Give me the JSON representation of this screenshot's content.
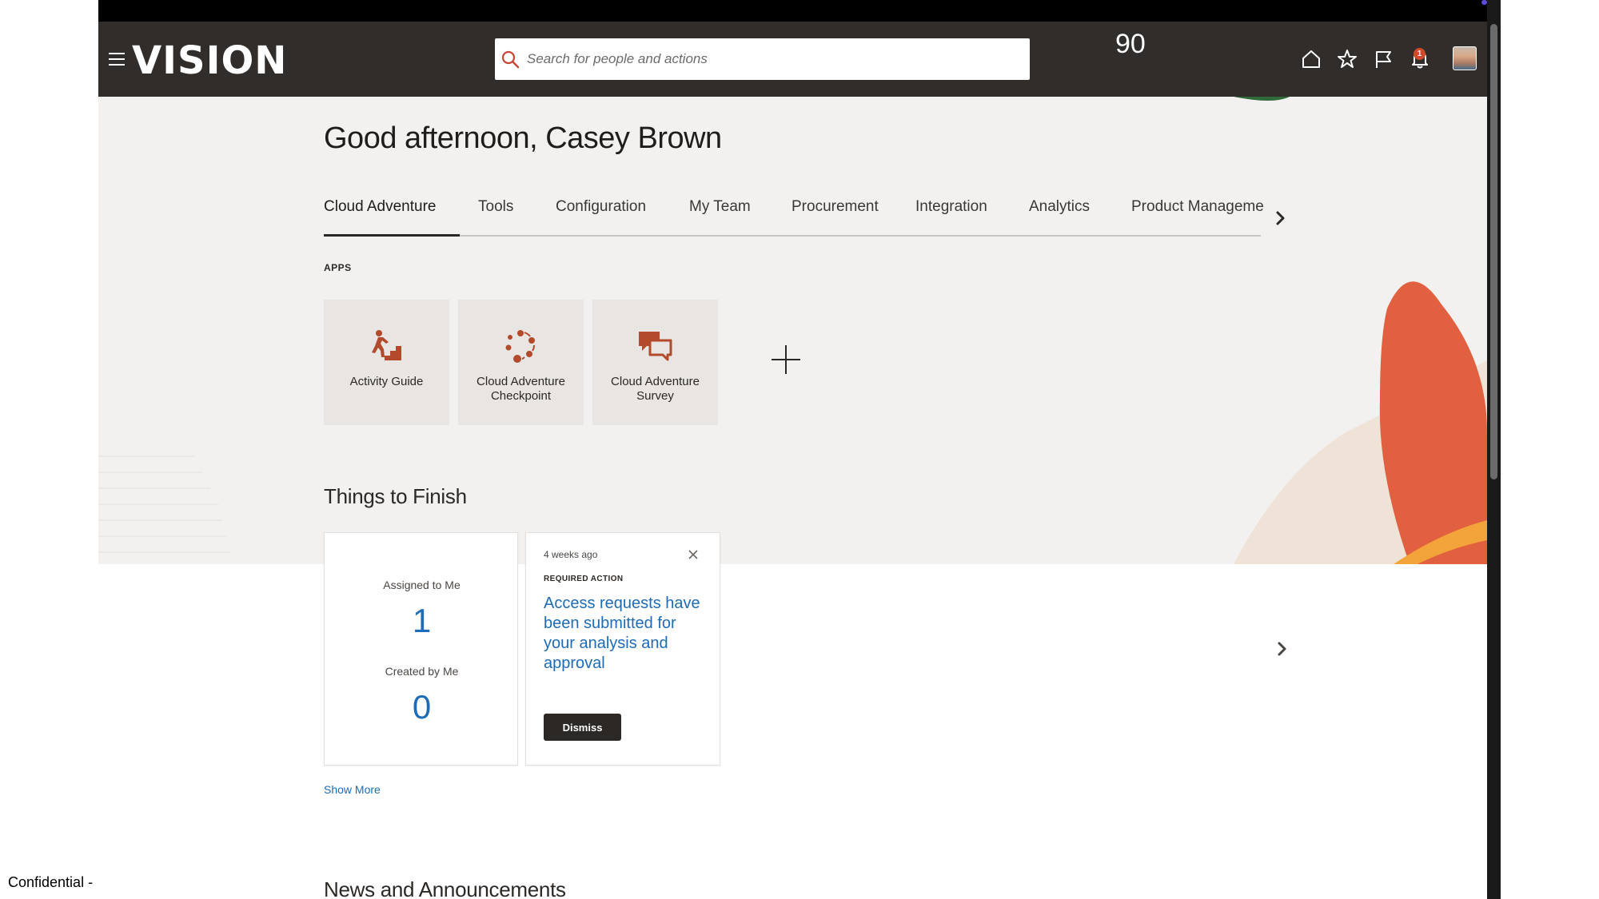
{
  "header": {
    "logo_text": "VISION",
    "search_placeholder": "Search for people and actions",
    "counter": "90",
    "notification_count": "1",
    "icons": [
      "menu-icon",
      "search-icon",
      "home-icon",
      "star-icon",
      "flag-icon",
      "bell-icon",
      "avatar"
    ]
  },
  "greeting": "Good afternoon, Casey Brown",
  "tabs": [
    {
      "label": "Cloud Adventure",
      "active": true
    },
    {
      "label": "Tools"
    },
    {
      "label": "Configuration"
    },
    {
      "label": "My Team"
    },
    {
      "label": "Procurement"
    },
    {
      "label": "Integration"
    },
    {
      "label": "Analytics"
    },
    {
      "label": "Product Manageme"
    }
  ],
  "apps": {
    "section_label": "APPS",
    "items": [
      {
        "label": "Activity Guide",
        "icon": "climbing-stairs-icon"
      },
      {
        "label": "Cloud Adventure Checkpoint",
        "icon": "cycle-dots-icon"
      },
      {
        "label": "Cloud Adventure Survey",
        "icon": "chat-bubbles-icon"
      }
    ]
  },
  "things_to_finish": {
    "title": "Things to Finish",
    "assigned_label": "Assigned to Me",
    "assigned_count": "1",
    "created_label": "Created by Me",
    "created_count": "0",
    "action_card": {
      "time": "4 weeks ago",
      "type": "REQUIRED ACTION",
      "title": "Access requests have been submitted for your analysis and approval",
      "dismiss_label": "Dismiss"
    },
    "show_more": "Show More"
  },
  "news_title": "News and Announcements",
  "footer_note": "Confidential -",
  "colors": {
    "header_bg": "#312d2a",
    "hero_bg": "#f3f1ef",
    "link_blue": "#1e6bb8",
    "icon_rust": "#b24a2b",
    "leaf_orange": "#e0603f"
  }
}
